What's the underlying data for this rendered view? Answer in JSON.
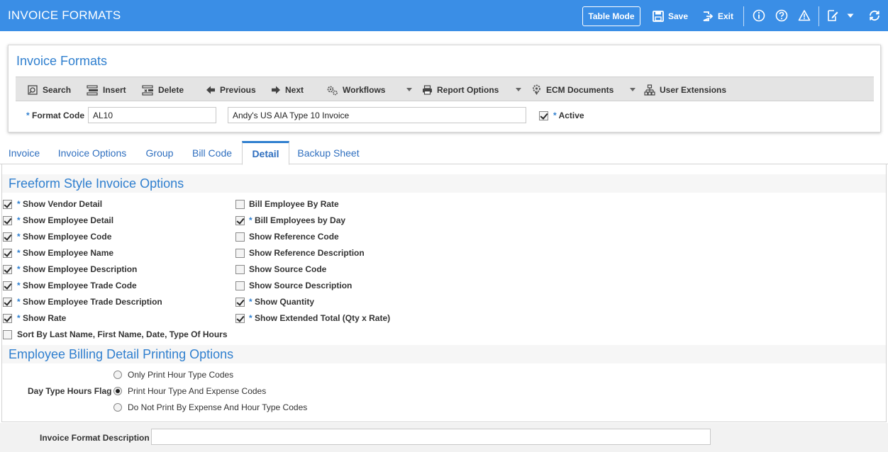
{
  "app": {
    "title": "INVOICE FORMATS",
    "table_mode": "Table Mode",
    "save": "Save",
    "exit": "Exit",
    "accent": "#3a8ee6"
  },
  "header": {
    "title": "Invoice Formats",
    "toolbar": {
      "search": "Search",
      "insert": "Insert",
      "delete": "Delete",
      "previous": "Previous",
      "next": "Next",
      "workflows": "Workflows",
      "report_options": "Report Options",
      "ecm_documents": "ECM Documents",
      "user_extensions": "User Extensions"
    },
    "format_code_label": "Format Code",
    "format_code_value": "AL10",
    "description_value": "Andy's US AIA Type 10 Invoice",
    "active_label": "Active",
    "active_checked": true,
    "required_mark": "*"
  },
  "tabs": [
    {
      "label": "Invoice",
      "active": false
    },
    {
      "label": "Invoice Options",
      "active": false
    },
    {
      "label": "Group",
      "active": false
    },
    {
      "label": "Bill Code",
      "active": false
    },
    {
      "label": "Detail",
      "active": true
    },
    {
      "label": "Backup Sheet",
      "active": false
    }
  ],
  "freeform": {
    "title": "Freeform Style Invoice Options",
    "left": [
      {
        "label": "Show Vendor Detail",
        "required": true,
        "checked": true
      },
      {
        "label": "Show Employee Detail",
        "required": true,
        "checked": true
      },
      {
        "label": "Show Employee Code",
        "required": true,
        "checked": true
      },
      {
        "label": "Show Employee Name",
        "required": true,
        "checked": true
      },
      {
        "label": "Show Employee Description",
        "required": true,
        "checked": true
      },
      {
        "label": "Show Employee Trade Code",
        "required": true,
        "checked": true
      },
      {
        "label": "Show Employee Trade Description",
        "required": true,
        "checked": true
      },
      {
        "label": "Show Rate",
        "required": true,
        "checked": true
      },
      {
        "label": "Sort By Last Name, First Name, Date, Type Of Hours",
        "required": false,
        "checked": false
      }
    ],
    "right": [
      {
        "label": "Bill Employee By Rate",
        "required": false,
        "checked": false
      },
      {
        "label": "Bill Employees by Day",
        "required": true,
        "checked": true
      },
      {
        "label": "Show Reference Code",
        "required": false,
        "checked": false
      },
      {
        "label": "Show Reference Description",
        "required": false,
        "checked": false
      },
      {
        "label": "Show Source Code",
        "required": false,
        "checked": false
      },
      {
        "label": "Show Source Description",
        "required": false,
        "checked": false
      },
      {
        "label": "Show Quantity",
        "required": true,
        "checked": true
      },
      {
        "label": "Show Extended Total (Qty x Rate)",
        "required": true,
        "checked": true
      }
    ]
  },
  "billing": {
    "title": "Employee Billing Detail Printing Options",
    "flag_label": "Day Type Hours Flag",
    "options": [
      {
        "label": "Only Print Hour Type Codes",
        "selected": false
      },
      {
        "label": "Print Hour Type And Expense Codes",
        "selected": true
      },
      {
        "label": "Do Not Print By Expense And Hour Type Codes",
        "selected": false
      }
    ]
  },
  "footer": {
    "description_label": "Invoice Format Description",
    "description_value": ""
  }
}
